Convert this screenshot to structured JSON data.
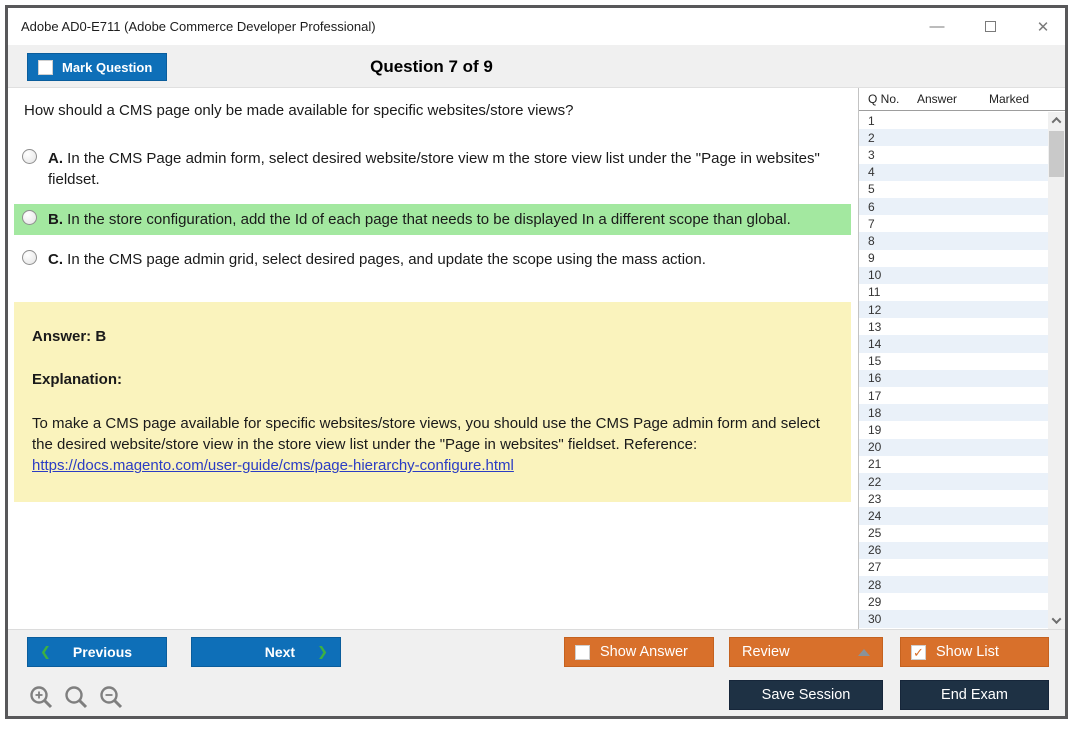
{
  "window": {
    "title": "Adobe AD0-E711 (Adobe Commerce Developer Professional)"
  },
  "icons": {
    "minimize": "—",
    "close": "✕",
    "prev_chevron": "❮",
    "next_chevron": "❯",
    "check": "✓"
  },
  "header": {
    "mark_question_label": "Mark Question",
    "question_counter": "Question 7 of 9"
  },
  "question": {
    "text": "How should a CMS page only be made available for specific websites/store views?",
    "options": [
      {
        "letter": "A.",
        "text": "In the CMS Page admin form, select desired website/store view m the store view list under the \"Page in websites\" fieldset.",
        "highlighted": false,
        "selected": false
      },
      {
        "letter": "B.",
        "text": "In the store configuration, add the Id of each page that needs to be displayed In a different scope than global.",
        "highlighted": true,
        "selected": false
      },
      {
        "letter": "C.",
        "text": "In the CMS page admin grid, select desired pages, and update the scope using the mass action.",
        "highlighted": false,
        "selected": false
      }
    ]
  },
  "explanation": {
    "answer_label": "Answer: B",
    "explanation_label": "Explanation:",
    "body": "To make a CMS page available for specific websites/store views, you should use the CMS Page admin form and select the desired website/store view in the store view list under the \"Page in websites\" fieldset. Reference:",
    "link": "https://docs.magento.com/user-guide/cms/page-hierarchy-configure.html"
  },
  "question_list": {
    "columns": [
      "Q No.",
      "Answer",
      "Marked"
    ],
    "rows": [
      "1",
      "2",
      "3",
      "4",
      "5",
      "6",
      "7",
      "8",
      "9",
      "10",
      "11",
      "12",
      "13",
      "14",
      "15",
      "16",
      "17",
      "18",
      "19",
      "20",
      "21",
      "22",
      "23",
      "24",
      "25",
      "26",
      "27",
      "28",
      "29",
      "30"
    ]
  },
  "footer": {
    "previous_label": "Previous",
    "next_label": "Next",
    "show_answer_label": "Show Answer",
    "review_label": "Review",
    "show_list_label": "Show List",
    "show_list_checked": true,
    "show_answer_checked": false,
    "mark_question_checked": false,
    "save_session_label": "Save Session",
    "end_exam_label": "End Exam"
  },
  "colors": {
    "accent_blue": "#0e6fb8",
    "accent_orange": "#d8702b",
    "navy": "#1e3144",
    "highlight_green": "#a3e8a0",
    "explanation_yellow": "#faf3bd",
    "link_blue": "#2b3cc4",
    "chevron_green": "#3cb043",
    "row_stripe": "#eaf1f9",
    "chrome_gray": "#f0f0f0",
    "frame_gray": "#58585a"
  }
}
